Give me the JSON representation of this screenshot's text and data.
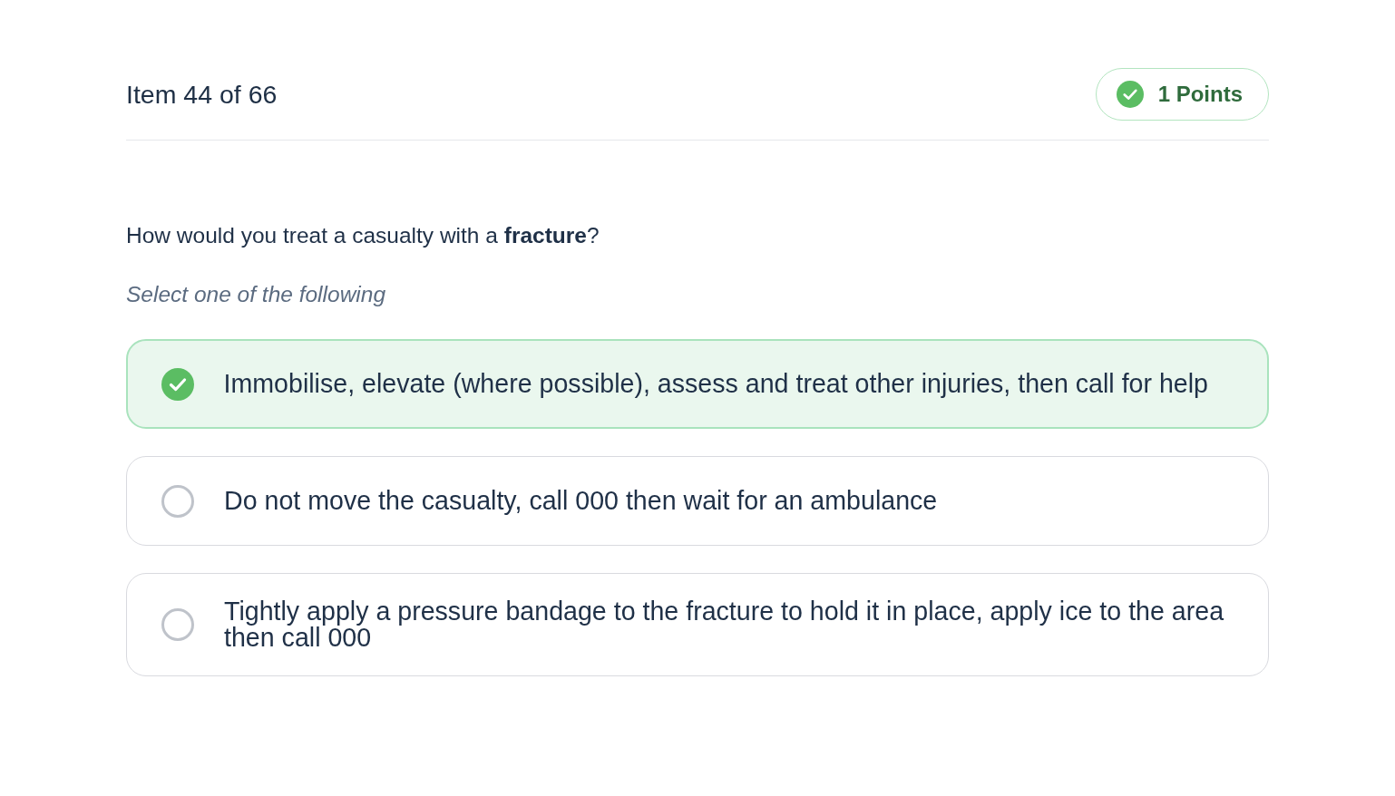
{
  "header": {
    "counter": "Item 44 of 66",
    "points_badge": {
      "label": "1 Points"
    }
  },
  "question": {
    "text": "How would you treat a casualty with a **fracture**?",
    "instruction": "Select one of the following"
  },
  "options": [
    {
      "label": "Immobilise, elevate (where possible), assess and treat other injuries, then call for help",
      "selected": true
    },
    {
      "label": "Do not move the casualty, call 000 then wait for an ambulance",
      "selected": false
    },
    {
      "label": "Tightly apply a pressure bandage to the fracture to hold it in place, apply ice to the area then call 000",
      "selected": false
    }
  ]
}
